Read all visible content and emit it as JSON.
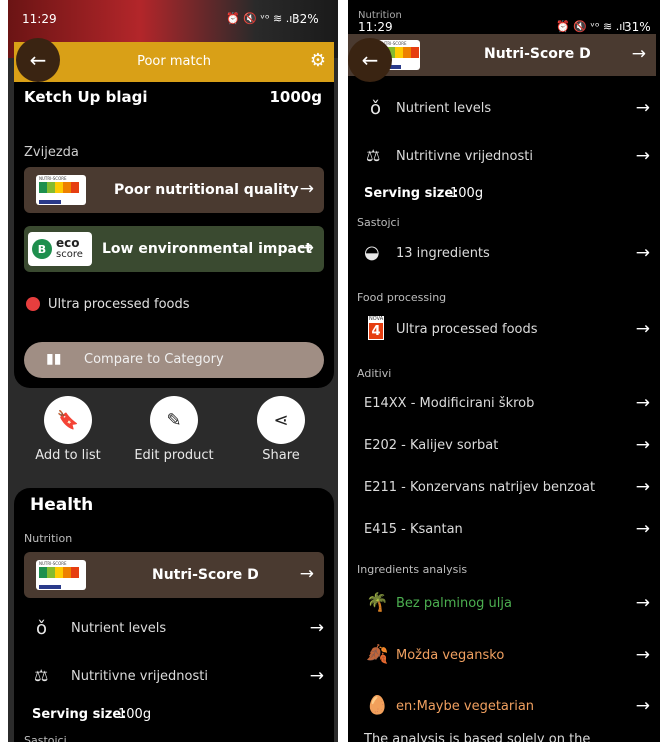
{
  "left": {
    "status": {
      "time": "11:29",
      "icons": "⏰ 🔇 ᵛᵒ ≋ .ıl",
      "battery": "32%"
    },
    "match_bar": {
      "label": "Poor match"
    },
    "product": {
      "name": "Ketch Up blagi",
      "quantity": "1000g"
    },
    "brand_section": "Zvijezda",
    "nutrition_quality": {
      "label": "Poor nutritional quality"
    },
    "eco": {
      "label": "Low environmental impact",
      "badge_letter": "B",
      "badge_top": "eco",
      "badge_bottom": "score"
    },
    "nova": {
      "label": "Ultra processed foods"
    },
    "compare": {
      "label": "Compare to Category"
    },
    "actions": [
      {
        "label": "Add to list"
      },
      {
        "label": "Edit product"
      },
      {
        "label": "Share"
      }
    ],
    "health": {
      "title": "Health",
      "nutrition_section": "Nutrition",
      "nutriscore_label": "Nutri-Score D",
      "nutrient_levels": "Nutrient levels",
      "nutritional_values": "Nutritivne vrijednosti",
      "serving_label": "Serving size:",
      "serving_value": "100g",
      "next_section": "Sastojci"
    }
  },
  "right": {
    "status": {
      "label": "Nutrition",
      "time": "11:29",
      "icons": "⏰ 🔇 ᵛᵒ ≋ .ıl",
      "battery": "31%"
    },
    "header_title": "Nutri-Score D",
    "nutrient_levels": "Nutrient levels",
    "nutritional_values": "Nutritivne vrijednosti",
    "serving_label": "Serving size:",
    "serving_value": "100g",
    "ingredients_section": "Sastojci",
    "ingredients_count": "13 ingredients",
    "processing_section": "Food processing",
    "nova_badge": "4",
    "nova_badge_top": "NOVA",
    "nova_label": "Ultra processed foods",
    "additives_section": "Aditivi",
    "additives": [
      "E14XX - Modificirani škrob",
      "E202 - Kalijev sorbat",
      "E211 - Konzervans natrijev benzoat",
      "E415 - Ksantan"
    ],
    "analysis_section": "Ingredients analysis",
    "analysis": [
      {
        "label": "Bez palminog ulja",
        "color": "#4caf50"
      },
      {
        "label": "Možda vegansko",
        "color": "#f0a060"
      },
      {
        "label": "en:Maybe vegetarian",
        "color": "#f0a060"
      }
    ],
    "footnote": "The analysis is based solely on the"
  },
  "colors": {
    "match_bar": "#d9a017",
    "card_brown": "#4a3a30",
    "card_green": "#3a4a30",
    "compare": "#a08e84"
  }
}
